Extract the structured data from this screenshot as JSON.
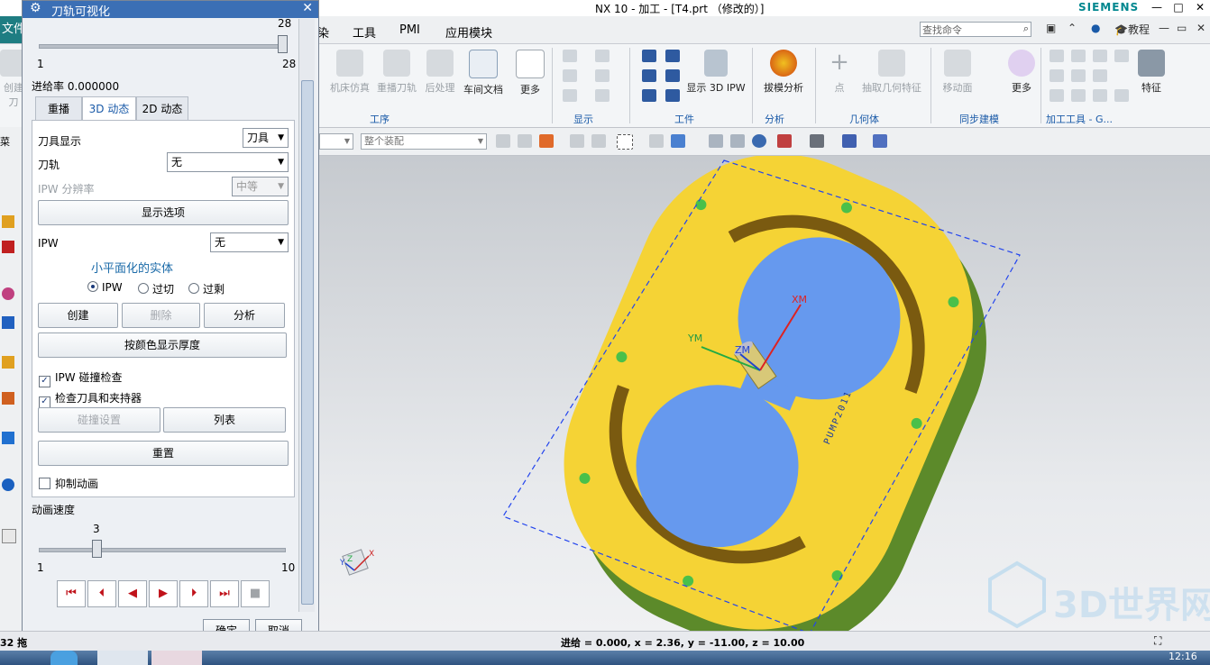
{
  "window": {
    "title": "NX 10 - 加工 - [T4.prt （修改的）]",
    "brand": "SIEMENS",
    "controls": [
      "—",
      "□",
      "✕"
    ]
  },
  "menubar": {
    "file": "文件",
    "items": [
      "染",
      "工具",
      "PMI",
      "应用模块"
    ],
    "search_placeholder": "查找命令",
    "tutorial": "教程"
  },
  "ribbon": {
    "left_buttons": [
      "创建刀",
      "机床仿真",
      "重播刀轨",
      "后处理",
      "车间文档",
      "更多"
    ],
    "group_process": "工序",
    "group_display": "显示",
    "show_3d_ipw": "显示 3D IPW",
    "group_toolpath": "工件",
    "draft_analysis": "拔模分析",
    "group_analysis": "分析",
    "point": "点",
    "extract_geometry": "抽取几何特征",
    "group_geometry": "几何体",
    "move_face": "移动面",
    "more": "更多",
    "group_sync": "同步建模",
    "group_machining_tools": "加工工具 - G...",
    "feature": "特征"
  },
  "toolbar2": {
    "left_label": "菜",
    "assembly_combo": "整个装配"
  },
  "dialog": {
    "title": "刀轨可视化",
    "top_slider": {
      "max_label": "28",
      "min_label": "1",
      "right_label": "28",
      "value_fraction": 1.0
    },
    "feed_rate": "进给率 0.000000",
    "tabs": [
      "重播",
      "3D 动态",
      "2D 动态"
    ],
    "active_tab": "3D 动态",
    "tool_display_label": "刀具显示",
    "tool_display_value": "刀具",
    "toolpath_label": "刀轨",
    "toolpath_value": "无",
    "ipw_resolution_label": "IPW 分辨率",
    "ipw_resolution_value": "中等",
    "display_options": "显示选项",
    "ipw_label": "IPW",
    "ipw_value": "无",
    "faceted_solid": "小平面化的实体",
    "radio_ipw": "IPW",
    "radio_overcut": "过切",
    "radio_excess": "过剩",
    "btn_create": "创建",
    "btn_delete": "删除",
    "btn_analyze": "分析",
    "btn_color_thickness": "按颜色显示厚度",
    "chk_ipw_collision": "IPW 碰撞检查",
    "chk_check_tool_holder": "检查刀具和夹持器",
    "btn_collision_settings": "碰撞设置",
    "btn_list": "列表",
    "btn_reset": "重置",
    "chk_suppress_animation": "抑制动画",
    "anim_speed_label": "动画速度",
    "speed_slider": {
      "value_label": "3",
      "min_label": "1",
      "max_label": "10",
      "value": 3
    },
    "ok": "确定",
    "cancel": "取消"
  },
  "viewport": {
    "axis_xm": "XM",
    "axis_ym": "YM",
    "axis_zm": "ZM",
    "part_text": "PUMP2011",
    "triad_x": "X",
    "triad_y": "Y",
    "triad_z": "Z",
    "watermark": "3D世界网"
  },
  "statusbar": {
    "left": "32 拖",
    "coords": "进给 = 0.000, x = 2.36, y = -11.00, z = 10.00"
  },
  "taskbar": {
    "clock": "12:16"
  },
  "colors": {
    "part_yellow": "#f5d335",
    "pocket_blue": "#6699ee",
    "accent_teal": "#1e7d82",
    "dialog_title": "#3b6fb5"
  }
}
